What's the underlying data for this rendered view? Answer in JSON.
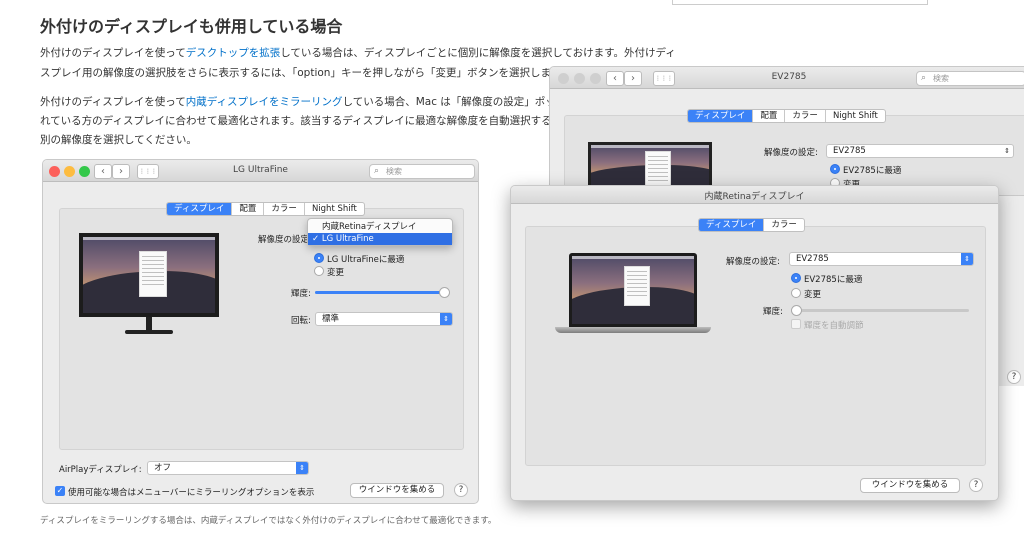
{
  "article": {
    "title": "外付けのディスプレイも併用している場合",
    "p1_a": "外付けのディスプレイを使って",
    "p1_link": "デスクトップを拡張",
    "p1_b": "している場合は、ディスプレイごとに個別に解像度を選択しておけます。外付けディ",
    "p1_line2": "スプレイ用の解像度の選択肢をさらに表示するには、「option」キーを押しながら「変更」ボタンを選択します。",
    "p2_a": "外付けのディスプレイを使って",
    "p2_link": "内蔵ディスプレイをミラーリング",
    "p2_b": "している場合、Mac は「解像度の設定」ポップアップ",
    "p2_line2": "れている方のディスプレイに合わせて最適化されます。該当するディスプレイに最適な解像度を自動選択するか、「",
    "p2_line3": "別の解像度を選択してください。",
    "caption": "ディスプレイをミラーリングする場合は、内蔵ディスプレイではなく外付けのディスプレイに合わせて最適化できます。"
  },
  "icons": {
    "back": "‹",
    "forward": "›",
    "grid": "⋮⋮⋮",
    "search": "⌕",
    "checkmark": "✓",
    "updown": "⇕",
    "help": "?"
  },
  "colors": {
    "accent": "#3b82f7",
    "link": "#0070c9",
    "close": "#fc605b",
    "minimize": "#fdbc40",
    "zoom": "#34c84a"
  },
  "lg_window": {
    "title": "LG UltraFine",
    "search_placeholder": "検索",
    "tabs": [
      "ディスプレイ",
      "配置",
      "カラー",
      "Night Shift"
    ],
    "active_tab": 0,
    "resolution_label": "解像度の設定:",
    "dropdown_options": [
      "内蔵Retinaディスプレイ",
      "LG UltraFine"
    ],
    "dropdown_selected": 1,
    "radio_optimal": "LG UltraFineに最適",
    "radio_change": "変更",
    "brightness_label": "輝度:",
    "brightness_level": 1.0,
    "rotation_label": "回転:",
    "rotation_value": "標準",
    "airplay_label": "AirPlayディスプレイ:",
    "airplay_value": "オフ",
    "mirror_checkbox": "使用可能な場合はメニューバーにミラーリングオプションを表示",
    "mirror_checked": true,
    "gather_button": "ウインドウを集める"
  },
  "ev_window": {
    "title": "EV2785",
    "search_placeholder": "検索",
    "tabs": [
      "ディスプレイ",
      "配置",
      "カラー",
      "Night Shift"
    ],
    "active_tab": 0,
    "resolution_label": "解像度の設定:",
    "resolution_value": "EV2785",
    "radio_optimal": "EV2785に最適",
    "radio_change": "変更"
  },
  "retina_window": {
    "title": "内蔵Retinaディスプレイ",
    "tabs": [
      "ディスプレイ",
      "カラー"
    ],
    "active_tab": 0,
    "resolution_label": "解像度の設定:",
    "resolution_value": "EV2785",
    "radio_optimal": "EV2785に最適",
    "radio_change": "変更",
    "brightness_label": "輝度:",
    "brightness_level": 0.0,
    "auto_brightness": "輝度を自動調節",
    "gather_button": "ウインドウを集める"
  }
}
